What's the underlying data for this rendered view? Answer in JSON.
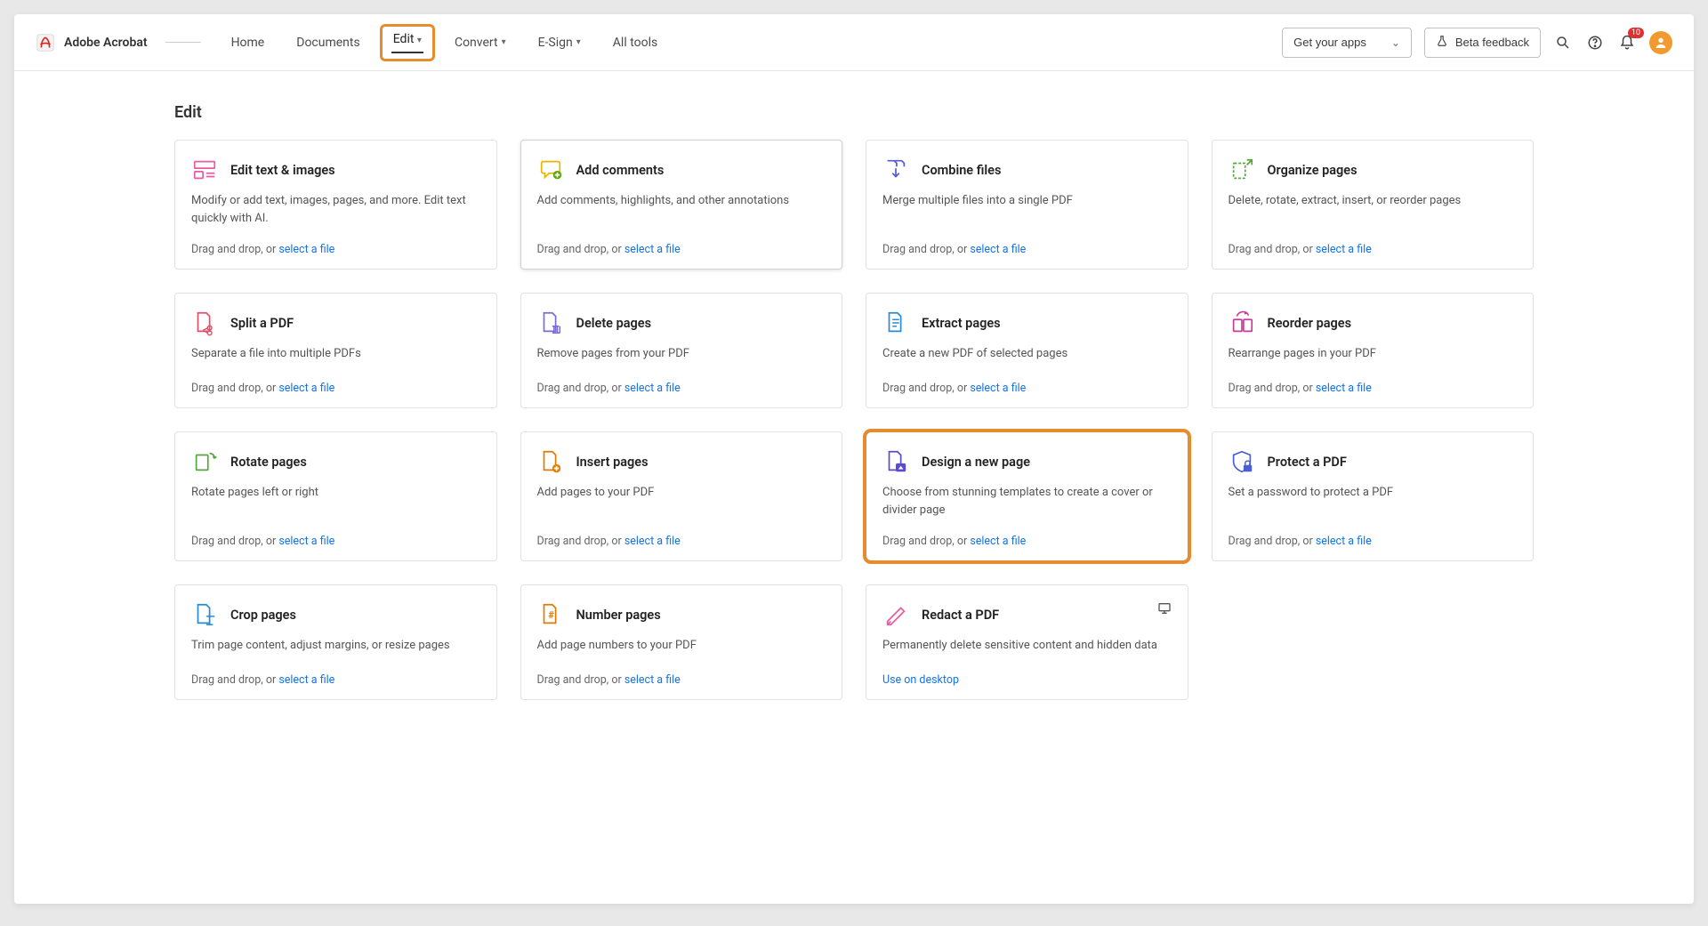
{
  "brand": "Adobe Acrobat",
  "nav": {
    "home": "Home",
    "documents": "Documents",
    "edit": "Edit",
    "convert": "Convert",
    "esign": "E-Sign",
    "alltools": "All tools"
  },
  "header": {
    "get_apps": "Get your apps",
    "beta": "Beta feedback",
    "notif_count": "10"
  },
  "page": {
    "title": "Edit"
  },
  "labels": {
    "dragdrop": "Drag and drop, or ",
    "select": "select a file",
    "use_desktop": "Use on desktop"
  },
  "cards": [
    {
      "title": "Edit text & images",
      "desc": "Modify or add text, images, pages, and more. Edit text quickly with AI."
    },
    {
      "title": "Add comments",
      "desc": "Add comments, highlights, and other annotations"
    },
    {
      "title": "Combine files",
      "desc": "Merge multiple files into a single PDF"
    },
    {
      "title": "Organize pages",
      "desc": "Delete, rotate, extract, insert, or reorder pages"
    },
    {
      "title": "Split a PDF",
      "desc": "Separate a file into multiple PDFs"
    },
    {
      "title": "Delete pages",
      "desc": "Remove pages from your PDF"
    },
    {
      "title": "Extract pages",
      "desc": "Create a new PDF of selected pages"
    },
    {
      "title": "Reorder pages",
      "desc": "Rearrange pages in your PDF"
    },
    {
      "title": "Rotate pages",
      "desc": "Rotate pages left or right"
    },
    {
      "title": "Insert pages",
      "desc": "Add pages to your PDF"
    },
    {
      "title": "Design a new page",
      "desc": "Choose from stunning templates to create a cover or divider page"
    },
    {
      "title": "Protect a PDF",
      "desc": "Set a password to protect a PDF"
    },
    {
      "title": "Crop pages",
      "desc": "Trim page content, adjust margins, or resize pages"
    },
    {
      "title": "Number pages",
      "desc": "Add page numbers to your PDF"
    },
    {
      "title": "Redact a PDF",
      "desc": "Permanently delete sensitive content and hidden data"
    }
  ]
}
